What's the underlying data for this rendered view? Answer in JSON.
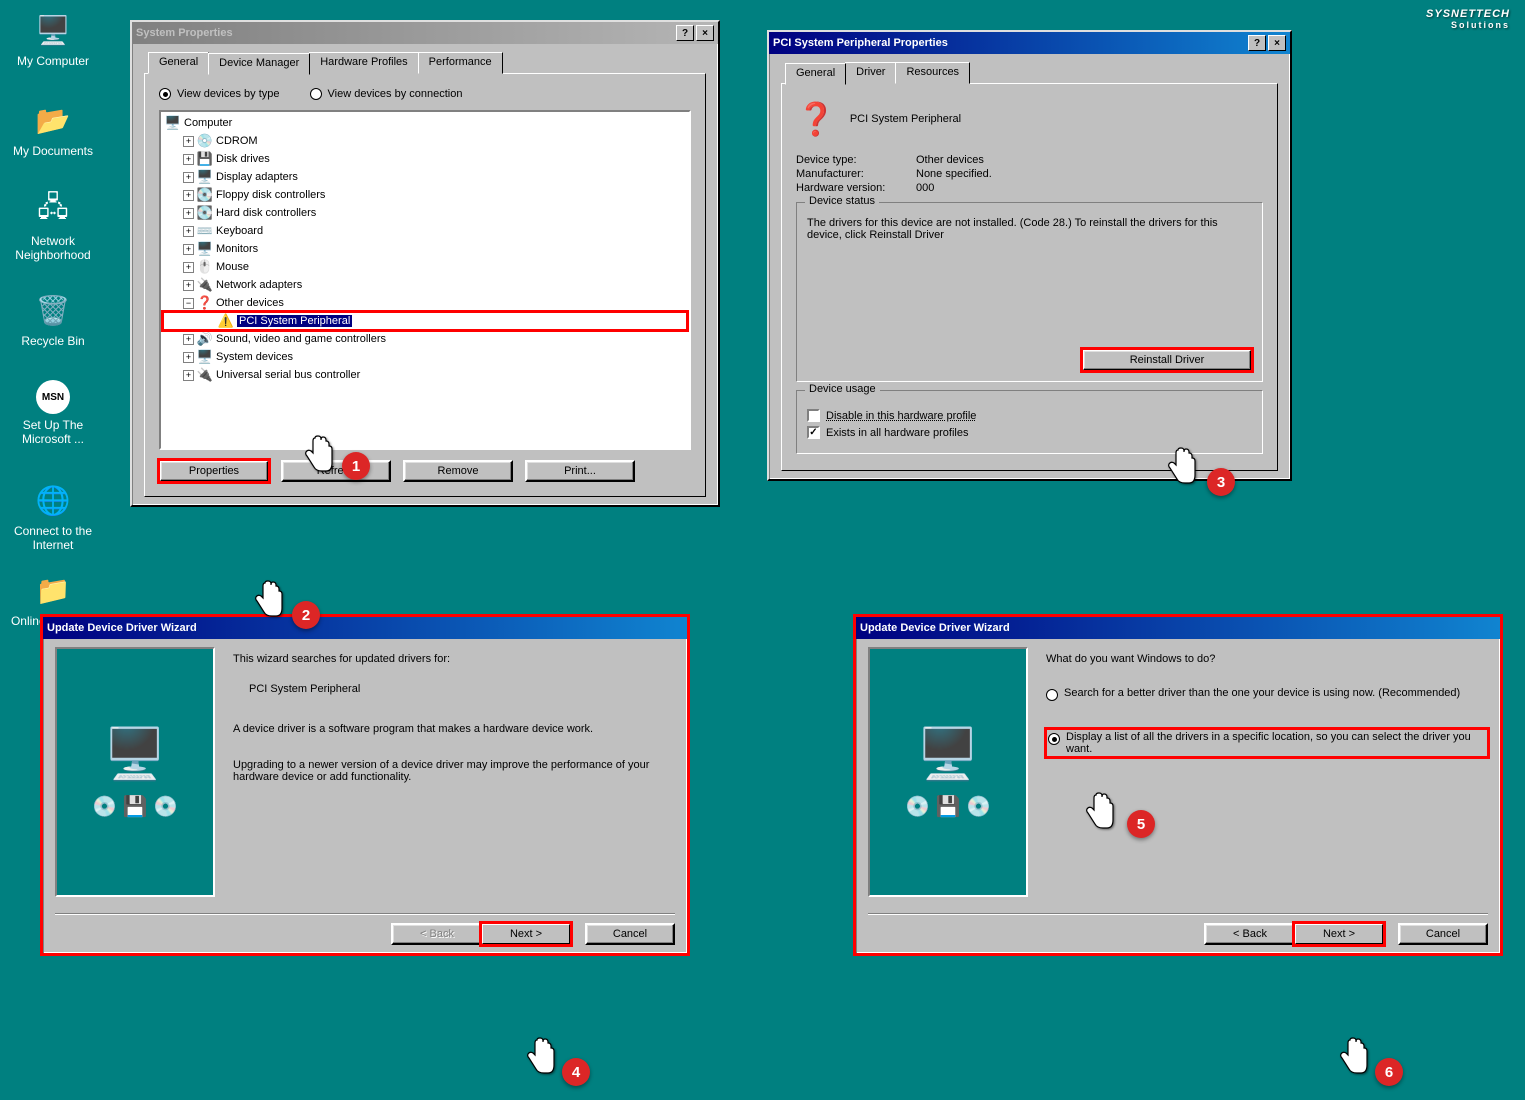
{
  "brand": {
    "name": "SYSNETTECH",
    "sub": "Solutions"
  },
  "desktop": {
    "icons": [
      {
        "label": "My Computer",
        "glyph": "🖥️"
      },
      {
        "label": "My Documents",
        "glyph": "📂"
      },
      {
        "label": "Network Neighborhood",
        "glyph": "🖥️"
      },
      {
        "label": "Recycle Bin",
        "glyph": "🗑️"
      },
      {
        "label": "MSN",
        "glyph": "MSN"
      },
      {
        "label": "Set Up The Microsoft ...",
        "glyph": ""
      },
      {
        "label": "Connect to the Internet",
        "glyph": "🌐"
      },
      {
        "label": "Online Services",
        "glyph": "📁"
      }
    ]
  },
  "sysprops": {
    "title": "System Properties",
    "tabs": [
      "General",
      "Device Manager",
      "Hardware Profiles",
      "Performance"
    ],
    "active_tab": "Device Manager",
    "radio": {
      "by_type": "View devices by type",
      "by_conn": "View devices by connection"
    },
    "tree": {
      "root": "Computer",
      "items": [
        {
          "label": "CDROM",
          "glyph": "💿"
        },
        {
          "label": "Disk drives",
          "glyph": "💾"
        },
        {
          "label": "Display adapters",
          "glyph": "🖥️"
        },
        {
          "label": "Floppy disk controllers",
          "glyph": "💽"
        },
        {
          "label": "Hard disk controllers",
          "glyph": "💽"
        },
        {
          "label": "Keyboard",
          "glyph": "⌨️"
        },
        {
          "label": "Monitors",
          "glyph": "🖥️"
        },
        {
          "label": "Mouse",
          "glyph": "🖱️"
        },
        {
          "label": "Network adapters",
          "glyph": "🔌"
        }
      ],
      "other": {
        "label": "Other devices",
        "child": "PCI System Peripheral"
      },
      "items2": [
        {
          "label": "Sound, video and game controllers",
          "glyph": "🔊"
        },
        {
          "label": "System devices",
          "glyph": "🖥️"
        },
        {
          "label": "Universal serial bus controller",
          "glyph": "🔌"
        }
      ]
    },
    "buttons": {
      "properties": "Properties",
      "refresh": "Refresh",
      "remove": "Remove",
      "print": "Print..."
    }
  },
  "devprops": {
    "title": "PCI System Peripheral Properties",
    "tabs": [
      "General",
      "Driver",
      "Resources"
    ],
    "device_name": "PCI System Peripheral",
    "rows": {
      "type_k": "Device type:",
      "type_v": "Other devices",
      "manu_k": "Manufacturer:",
      "manu_v": "None specified.",
      "hw_k": "Hardware version:",
      "hw_v": "000"
    },
    "status": {
      "legend": "Device status",
      "text": "The drivers for this device are not installed. (Code 28.) To reinstall the drivers for this device, click Reinstall Driver"
    },
    "reinstall": "Reinstall Driver",
    "usage": {
      "legend": "Device usage",
      "disable": "Disable in this hardware profile",
      "exists": "Exists in all hardware profiles"
    }
  },
  "wiz1": {
    "title": "Update Device Driver Wizard",
    "line1": "This wizard searches for updated drivers for:",
    "device": "PCI System Peripheral",
    "line2": "A device driver is a software program that makes a hardware device work.",
    "line3": "Upgrading to a newer version of a device driver may improve the performance of your hardware device or add functionality.",
    "back": "< Back",
    "next": "Next >",
    "cancel": "Cancel"
  },
  "wiz2": {
    "title": "Update Device Driver Wizard",
    "head": "What do you want Windows to do?",
    "opt1": "Search for a better driver than the one your device is using now. (Recommended)",
    "opt2": "Display a list of all the drivers in a specific location, so you can select the driver you want.",
    "back": "< Back",
    "next": "Next >",
    "cancel": "Cancel"
  },
  "callouts": {
    "c1": "1",
    "c2": "2",
    "c3": "3",
    "c4": "4",
    "c5": "5",
    "c6": "6"
  }
}
